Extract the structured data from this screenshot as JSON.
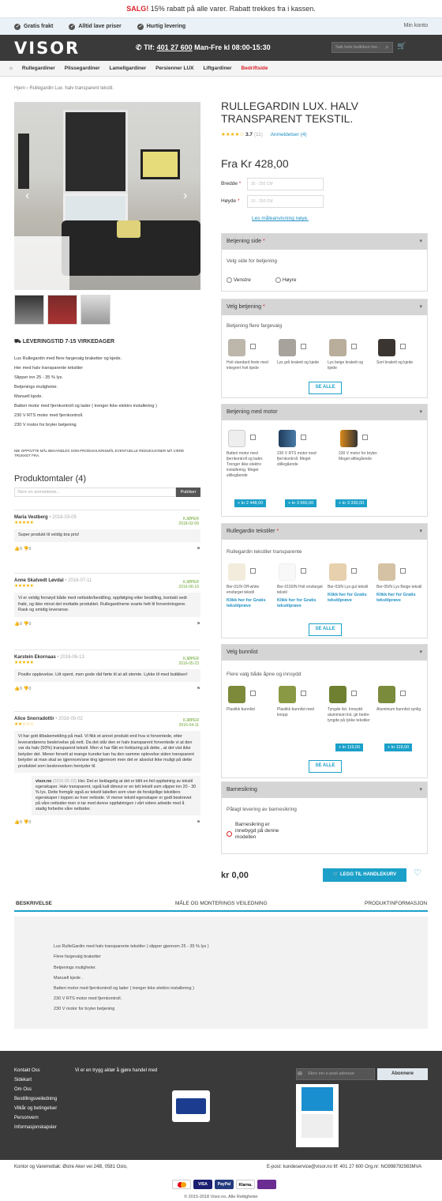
{
  "promo": {
    "sale": "SALG!",
    "text": "15% rabatt på alle varer. Rabatt trekkes fra i kassen."
  },
  "usp": [
    "Gratis frakt",
    "Alltid lave priser",
    "Hurtig levering"
  ],
  "my_account": "Min konto",
  "logo": "VISOR",
  "phone": {
    "label": "Tlf:",
    "number": "401 27 600",
    "hours": "Man-Fre kl 08:00-15:30"
  },
  "search": {
    "placeholder": "Søk hele butikken her..."
  },
  "menu": [
    "Rullegardiner",
    "Plissegardiner",
    "Lamellgardiner",
    "Persienner LUX",
    "Liftgardiner",
    "Bedriftside"
  ],
  "breadcrumb": {
    "home": "Hjem",
    "current": "Rullegardin Lux. halv transparent tekstil."
  },
  "product": {
    "title": "RULLEGARDIN LUX. HALV TRANSPARENT TEKSTIL.",
    "rating": "3.7",
    "rating_count": "(11)",
    "reviews_link": "Anmeldelser (4)",
    "price": "Fra Kr 428,00",
    "width_label": "Bredde",
    "width_placeholder": "35 - 250 CM",
    "height_label": "Høyde",
    "height_placeholder": "10 - 250 CM",
    "guide_link": "Les måleanvisning nøye.",
    "delivery": "LEVERINGSTID 7-15 VIRKEDAGER",
    "desc": [
      "Lux Rullegardin med flere fargevalg braketter og kjede.",
      "Her med halv transparente tekstiler",
      "Slipper inn 25 - 35 % lys.",
      "Betjenings muligheter.",
      "Manuell kjede.",
      "Batteri motor med fjernkontroll og lader ( trenger ikke elektro installering )",
      "230 V RTS motor med fjernkontroll.",
      "230 V motor for bryter betjening"
    ],
    "note": "NB! OPPGITTE MÅL BEHANDLES SOM PRODUKSJONSMÅL EVENTUELLE REDUKSJONER MÅ VÆRE TRUKKET FRA."
  },
  "reviews": {
    "title": "Produktomtaler (4)",
    "placeholder": "Skriv en anmeldelse...",
    "publish": "Publiser",
    "bought": "KJØPER",
    "items": [
      {
        "name": "Maria Vestberg",
        "date": "2018-03-05",
        "stars": "★★★★★",
        "bought_date": "2018-02-09",
        "text": "Super produkt til veldig bra pris!",
        "up": "0",
        "down": "0"
      },
      {
        "name": "Anne Skatvedt Løvdal",
        "date": "2016-07-11",
        "stars": "★★★★★",
        "bought_date": "2016-06-19",
        "text": "Vi er veldig fornøyd både med nettside/bestilling, oppfølging etter bestilling, kontakt vedr frakt, og ikke minst det mottatte produktet. Rullegardinene svarte helt til forventningene. Rask og smidig leveranse.",
        "up": "0",
        "down": "0"
      },
      {
        "name": "Karstein Ekornaas",
        "date": "2016-06-13",
        "stars": "★★★★★",
        "bought_date": "2016-05-23",
        "text": "Positiv opplevelse. Litt spent, men gode råd førte til at alt stemte. Lykke til med butikken!",
        "up": "0",
        "down": "0"
      },
      {
        "name": "Alice Snorradottir",
        "date": "2016-05-02",
        "stars": "★★☆☆☆",
        "bought_date": "2016-04-11",
        "text": "Vi har gott tilbakemelding på mail. Vi fikk et annet produkt end hva vi forventede, etter leverandørens beskrivelse på nett. Da det står den er halv transparent forventede vi at den var da halv (50%) transparent tekstil. Men vi har fått en forklaring på dette., at det vist ikke betyder det. Mener forsett at mange kunder kan ha den samme oplevelse siden transparent betyder at man skal se igjennom/ane ting igjennom men det er absolut ikke muligt på dette produktet som beskrevelsen hentyder til.",
        "reply_name": "visor.no",
        "reply_date": "(2016-05-02)",
        "reply": "Hei. Det er beklagelig at det er blitt en feil oppfatning av tekstil egenskaper. Halv transparent, også kalt dimout er en tett tekstil som slipper inn 20 - 30 % lys. Dette fremgår også av tekstil tabellen som viser de forskjellige tekstilers egenskaper i toppen av hver nettside. Vi mener tekstil egenskaper er godt beskrevet på våre nettsider men vi tar med denne oppfatningen i vårt videre arbeide med å stadig forbedre våre nettsider.",
        "up": "0",
        "down": "0"
      }
    ]
  },
  "options": {
    "side": {
      "title": "Betjening side",
      "sub": "Velg side for betjening",
      "left": "Venstre",
      "right": "Høyre"
    },
    "betjening": {
      "title": "Velg betjening",
      "sub": "Betjening flere fargevalg",
      "items": [
        "Hvit standard feste med integrert hvit kjede",
        "Lys grå brakett og kjede",
        "Lys beige brakett og kjede",
        "Sort brakett og kjede"
      ],
      "see_all": "SE ALLE"
    },
    "motor": {
      "title": "Betjening med motor",
      "items": [
        "Batteri motor med fjernkontroll og lader. Trenger ikke elektro installering. Meget stillegående",
        "230 V RTS motor med fjernkontroll. Meget stillegående",
        "230 V motor for bryter. Meget stillegående"
      ],
      "prices": [
        "+ kr 2 448,00",
        "+ kr 3 660,00",
        "+ kr 3 330,00"
      ]
    },
    "tekstil": {
      "title": "Rullegardin tekstiler",
      "sub": "Rullegardin tekstiler transparente",
      "items": [
        "Ber-01/N Off-white ensfarget tekstil",
        "Ber-0150/N Hvit ensfarget tekstil",
        "Ber-03/N Lys gul tekstil",
        "Ber-05/N Lys Beige tekstil"
      ],
      "link": "Klikk her for Gratis tekstilprøve",
      "see_all": "SE ALLE"
    },
    "bunnlist": {
      "title": "Velg bunnlist",
      "sub": "Flere valg både åpne og innsydd",
      "items": [
        "Plastikk bunnlist",
        "Plastikk bunnlist med knopp",
        "Tyngde list. Innsydd aluminium list, gir bedre tyngde på tykke tekstiler",
        "Aluminium bunnlist synlig"
      ],
      "prices": [
        "+ kr 119,00",
        "+ kr 119,00"
      ],
      "see_all": "SE ALLE"
    },
    "barn": {
      "title": "Barnesikring",
      "sub": "Pålagt levering av barnesikring",
      "item": "Barnesikring er innebygd på denne modellen"
    }
  },
  "total": "kr 0,00",
  "add_to_cart": "LEGG TIL HANDLEKURV",
  "tabs": [
    "BESKRIVELSE",
    "MÅLE OG MONTERINGS VEILEDNING",
    "PRODUKTINFORMASJON"
  ],
  "tab_desc": [
    "Lux RulleGardin med halv transparente tekstiler ( slipper gjennom 25 - 35 % lys )",
    "Flere fargevalg braketter",
    "Betjenings muligheter.",
    "Manuell kjede .",
    "Batteri motor med fjernkontroll og lader ( trenger ikke elektro installering )",
    "230 V RTS motor med fjernkontroll.",
    "230 V motor for bryter betjening"
  ],
  "footer": {
    "links": [
      "Kontakt Oss",
      "Sidekart",
      "Om Oss",
      "Bestillingsveiledning",
      "Vilkår og betingelser",
      "Personvern",
      "Informasjonskapsler"
    ],
    "trust": "Vi er en trygg aktør å gjøre handel med",
    "newsletter_placeholder": "Skriv inn e-post adresse",
    "subscribe": "Abonnere",
    "address": "Kontor og Varemottak: Østre Aker vei 24B, 0581 Oslo,",
    "contact": "E-post: kundeservice@visor.no  tlf: 401 27 600 Org.nr: NO998792983MVA",
    "payments": [
      "VISA",
      "PayPal",
      "Klarna."
    ],
    "copyright": "© 2015-2018 Visor.no, Alle Rettigheter"
  }
}
